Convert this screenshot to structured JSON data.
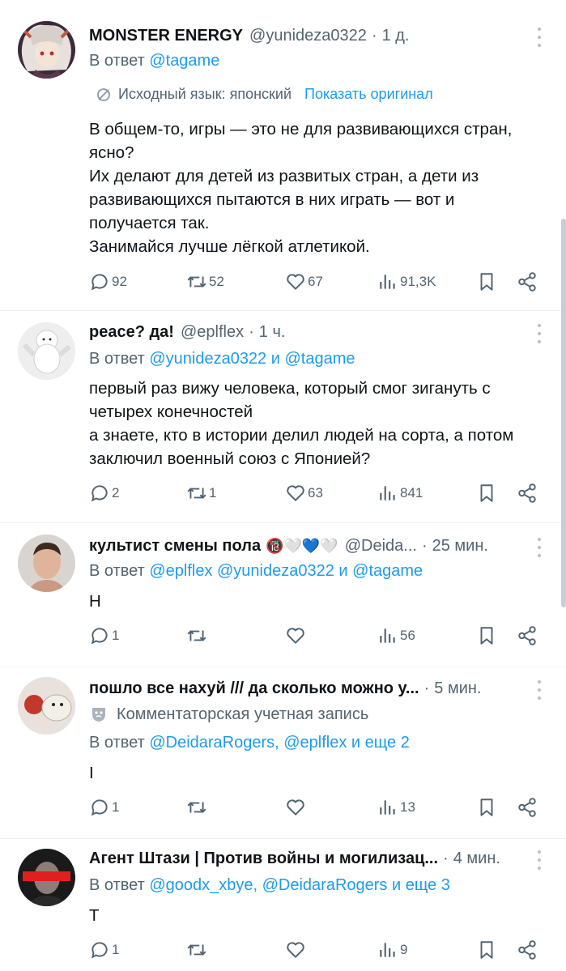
{
  "tweets": [
    {
      "name": "MONSTER ENERGY",
      "handle": "@yunideza0322",
      "time": "1 д.",
      "reply_prefix": "В ответ",
      "reply_mentions": "@tagame",
      "translation": {
        "label": "Исходный язык: японский",
        "show_original": "Показать оригинал"
      },
      "lines": [
        "В общем-то, игры — это не для развивающихся стран,",
        "ясно?",
        "Их делают для детей из развитых стран, а дети из",
        "развивающихся пытаются в них играть — вот и",
        "получается так.",
        "Занимайся лучше лёгкой атлетикой."
      ],
      "stats": {
        "replies": "92",
        "retweets": "52",
        "likes": "67",
        "views": "91,3K"
      }
    },
    {
      "name": "peace? да!",
      "handle": "@eplflex",
      "time": "1 ч.",
      "reply_prefix": "В ответ",
      "reply_mentions": "@yunideza0322 и @tagame",
      "lines": [
        "первый раз вижу человека, который смог зигануть с",
        "четырех конечностей",
        "а знаете, кто в истории делил людей на сорта, а потом",
        "заключил военный союз с Японией?"
      ],
      "stats": {
        "replies": "2",
        "retweets": "1",
        "likes": "63",
        "views": "841"
      }
    },
    {
      "name": "культист смены пола",
      "name_emoji": "🔞🤍💙🤍",
      "handle": "@Deida...",
      "time": "25 мин.",
      "reply_prefix": "В ответ",
      "reply_mentions": "@eplflex @yunideza0322 и @tagame",
      "lines": [
        "Н"
      ],
      "stats": {
        "replies": "1",
        "retweets": "",
        "likes": "",
        "views": "56"
      }
    },
    {
      "name": "пошло все нахуй /// да сколько можно у...",
      "handle": "",
      "time": "5 мин.",
      "community": "Комментаторская учетная запись",
      "reply_prefix": "В ответ",
      "reply_mentions": "@DeidaraRogers, @eplflex и еще 2",
      "lines": [
        "I"
      ],
      "stats": {
        "replies": "1",
        "retweets": "",
        "likes": "",
        "views": "13"
      }
    },
    {
      "name": "Агент Штази | Против войны и могилизац...",
      "handle": "",
      "time": "4 мин.",
      "reply_prefix": "В ответ",
      "reply_mentions": "@goodx_xbye, @DeidaraRogers и еще 3",
      "lines": [
        "Т"
      ],
      "stats": {
        "replies": "1",
        "retweets": "",
        "likes": "",
        "views": "9"
      }
    }
  ],
  "colors": {
    "accent": "#1d9bf0",
    "secondary": "#536471",
    "text": "#0f1419"
  }
}
